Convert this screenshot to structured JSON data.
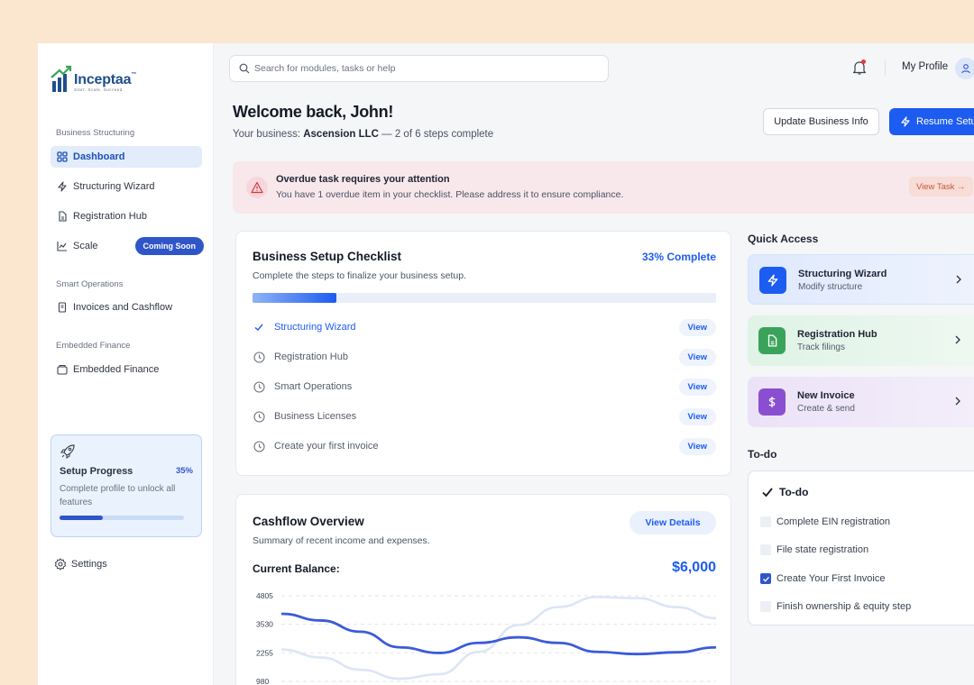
{
  "brand": {
    "name": "Inceptaa",
    "tagline": "Start. Scale. Succeed."
  },
  "sidebar": {
    "sections": [
      {
        "label": "Business Structuring"
      },
      {
        "label": "Smart Operations"
      },
      {
        "label": "Embedded Finance"
      }
    ],
    "items": [
      {
        "label": "Dashboard",
        "icon": "grid-icon",
        "active": true
      },
      {
        "label": "Structuring Wizard",
        "icon": "bolt-icon"
      },
      {
        "label": "Registration Hub",
        "icon": "document-icon"
      },
      {
        "label": "Scale",
        "icon": "chart-icon",
        "badge": "Coming Soon"
      },
      {
        "label": "Invoices and Cashflow",
        "icon": "receipt-icon"
      },
      {
        "label": "Embedded Finance",
        "icon": "wallet-icon"
      }
    ],
    "progress_card": {
      "title": "Setup Progress",
      "percent_label": "35%",
      "percent": 0.35,
      "description": "Complete profile to unlock all features"
    },
    "settings_label": "Settings"
  },
  "topbar": {
    "search_placeholder": "Search for modules, tasks or help",
    "profile_label": "My Profile"
  },
  "header": {
    "welcome": "Welcome back, John!",
    "business_prefix": "Your business:",
    "business_name": "Ascension LLC",
    "business_suffix": "— 2 of 6 steps complete",
    "update_button": "Update Business Info",
    "resume_button": "Resume Setup"
  },
  "alert": {
    "title": "Overdue task requires your attention",
    "text": "You have 1 overdue item in your checklist. Please address it to ensure compliance.",
    "button": "View Task →"
  },
  "checklist": {
    "title": "Business Setup Checklist",
    "percent_label": "33% Complete",
    "percent": 0.18,
    "subtitle": "Complete the steps to finalize your business setup.",
    "steps": [
      {
        "label": "Structuring Wizard",
        "done": true,
        "action": "View"
      },
      {
        "label": "Registration Hub",
        "done": false,
        "action": "View"
      },
      {
        "label": "Smart Operations",
        "done": false,
        "action": "View"
      },
      {
        "label": "Business Licenses",
        "done": false,
        "action": "View"
      },
      {
        "label": "Create your first invoice",
        "done": false,
        "action": "View"
      }
    ]
  },
  "cashflow": {
    "title": "Cashflow Overview",
    "subtitle": "Summary of recent income and expenses.",
    "button": "View Details",
    "balance_label": "Current Balance:",
    "balance_value": "$6,000",
    "chart_data": {
      "type": "line",
      "y_ticks": [
        4805,
        3530,
        2255,
        980
      ],
      "ylim": [
        980,
        4805
      ],
      "series": [
        {
          "color": "#3b5bd9",
          "values": [
            4000,
            3700,
            3200,
            2500,
            2250,
            2700,
            2950,
            2700,
            2300,
            2200,
            2280,
            2500
          ]
        },
        {
          "color": "#dde5f6",
          "values": [
            2400,
            2050,
            1500,
            1100,
            1300,
            2300,
            3500,
            4300,
            4750,
            4700,
            4300,
            3800
          ]
        }
      ]
    }
  },
  "quick_access": {
    "title": "Quick Access",
    "items": [
      {
        "title": "Structuring Wizard",
        "subtitle": "Modify structure",
        "icon": "bolt-icon"
      },
      {
        "title": "Registration Hub",
        "subtitle": "Track filings",
        "icon": "document-icon"
      },
      {
        "title": "New Invoice",
        "subtitle": "Create & send",
        "icon": "dollar-icon"
      }
    ]
  },
  "todo": {
    "heading": "To-do",
    "card_title": "To-do",
    "items": [
      {
        "label": "Complete EIN registration",
        "checked": false
      },
      {
        "label": "File state registration",
        "checked": false
      },
      {
        "label": "Create Your First Invoice",
        "checked": true
      },
      {
        "label": "Finish ownership & equity step",
        "checked": false
      }
    ]
  }
}
